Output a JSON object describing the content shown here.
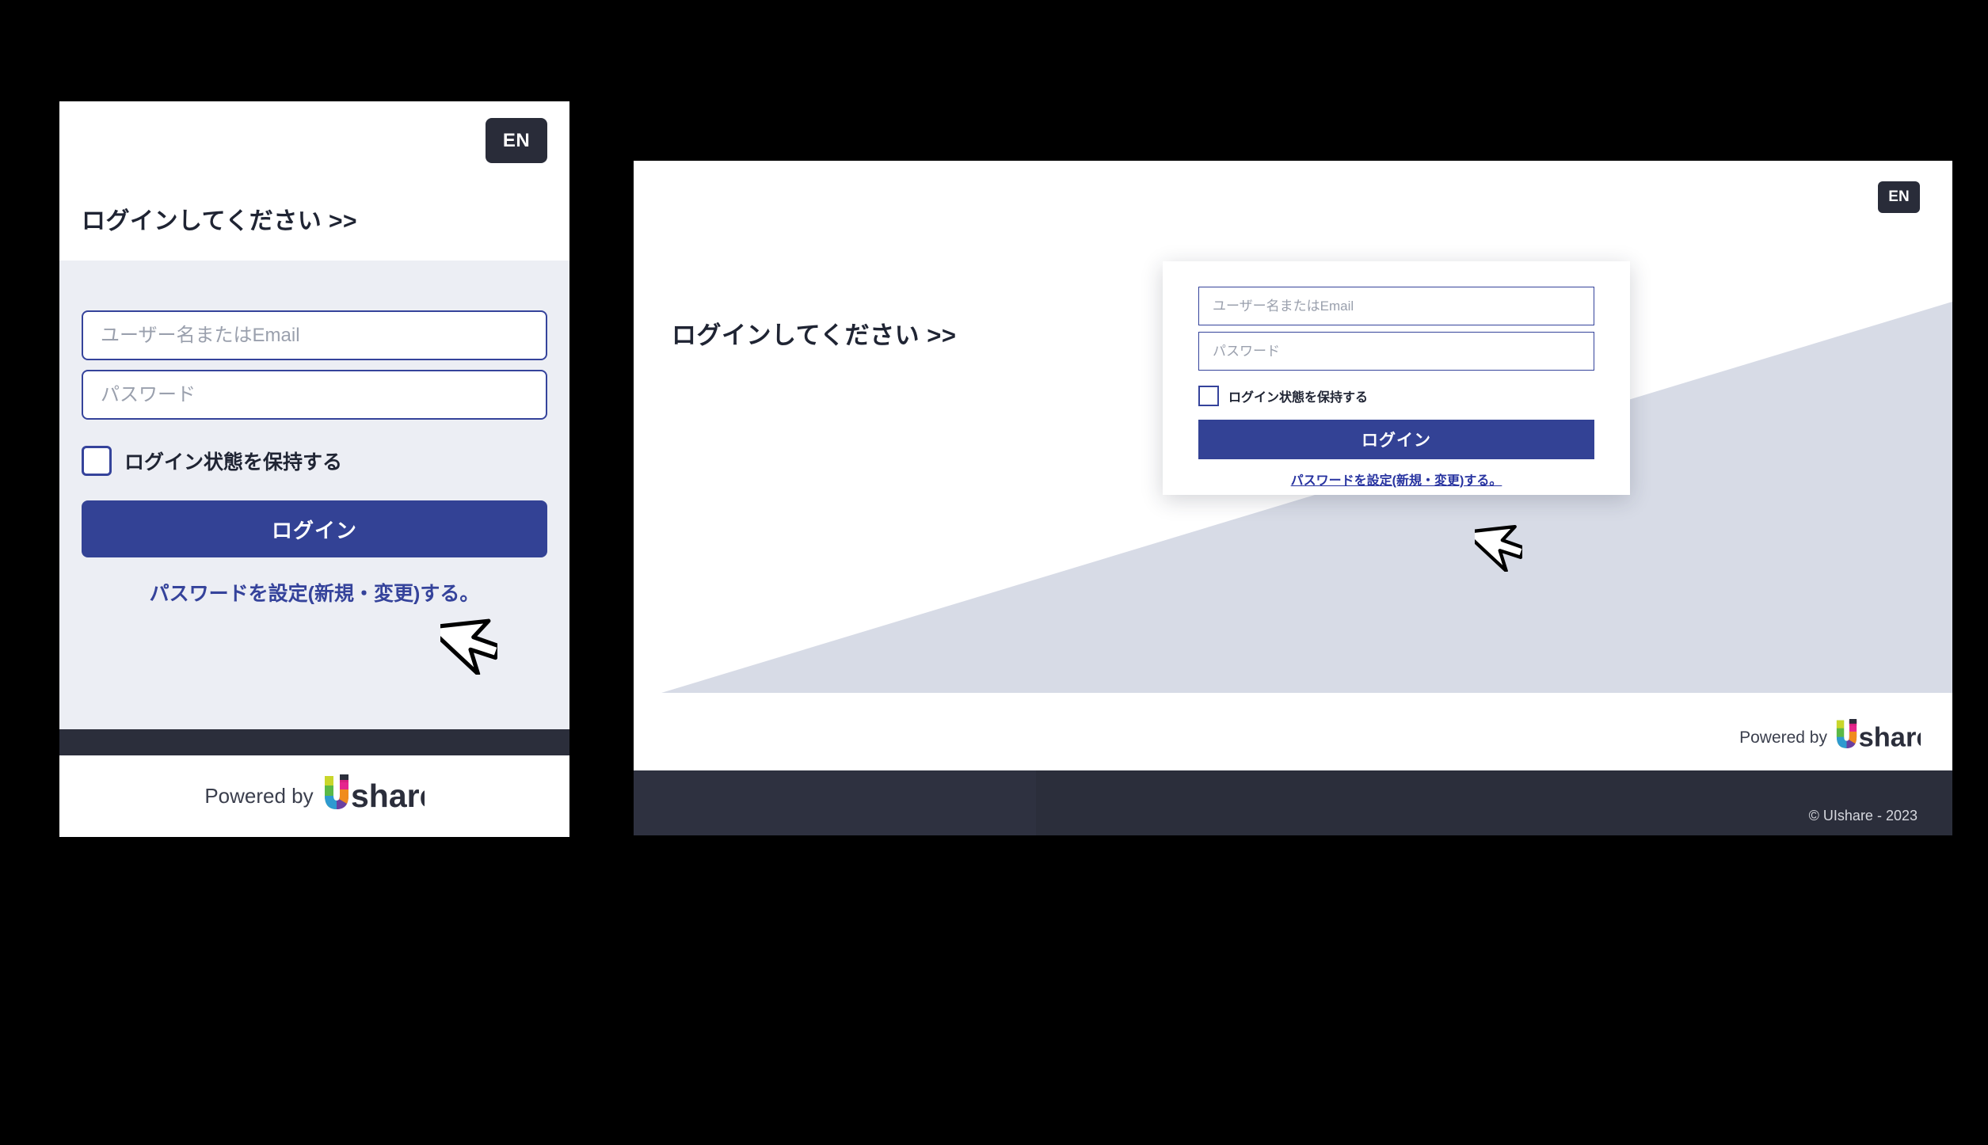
{
  "brand": {
    "accent_blue": "#334295",
    "border_blue": "#35439b",
    "dark": "#2b2e3b",
    "light_bg": "#eceef4",
    "diagonal_fill": "#d7dbe6",
    "logo_name": "Ushare"
  },
  "mobile": {
    "lang_button": "EN",
    "heading": "ログインしてください >>",
    "username_placeholder": "ユーザー名またはEmail",
    "username_value": "",
    "password_placeholder": "パスワード",
    "password_value": "",
    "remember_label": "ログイン状態を保持する",
    "remember_checked": false,
    "login_button": "ログイン",
    "password_link": "パスワードを設定(新規・変更)する。",
    "powered_by": "Powered by",
    "logo_text": "share"
  },
  "desktop": {
    "lang_button": "EN",
    "heading": "ログインしてください >>",
    "username_placeholder": "ユーザー名またはEmail",
    "username_value": "",
    "password_placeholder": "パスワード",
    "password_value": "",
    "remember_label": "ログイン状態を保持する",
    "remember_checked": false,
    "login_button": "ログイン",
    "password_link": "パスワードを設定(新規・変更)する。",
    "powered_by": "Powered by",
    "logo_text": "share",
    "copyright": "© UIshare - 2023"
  }
}
